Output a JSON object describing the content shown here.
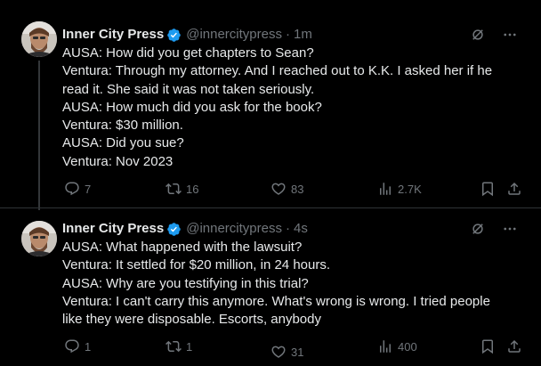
{
  "tweets": [
    {
      "name": "Inner City Press",
      "handle": "@innercitypress",
      "dot": "·",
      "time": "1m",
      "lines": [
        "AUSA: How did you get chapters to Sean?",
        "Ventura: Through my attorney. And I reached out to K.K. I asked her if he",
        "read it. She said it was not taken seriously.",
        "AUSA: How much did you ask for the book?",
        "Ventura: $30 million.",
        "AUSA: Did you sue?",
        "Ventura: Nov 2023"
      ],
      "replies": "7",
      "reposts": "16",
      "likes": "83",
      "views": "2.7K"
    },
    {
      "name": "Inner City Press",
      "handle": "@innercitypress",
      "dot": "·",
      "time": "4s",
      "lines": [
        "AUSA: What happened with the lawsuit?",
        "Ventura: It settled for $20 million, in 24 hours.",
        "AUSA: Why are you testifying in this trial?",
        "Ventura: I can't carry this anymore. What's wrong is wrong. I tried people",
        "like they were disposable. Escorts, anybody"
      ],
      "replies": "1",
      "reposts": "1",
      "likes": "31",
      "views": "400"
    }
  ],
  "colors": {
    "background": "#000000",
    "text": "#e7e9ea",
    "muted": "#71767b",
    "verified": "#1d9bf0",
    "divider": "#2f3336"
  },
  "icons": [
    "verified-badge-icon",
    "grok-icon",
    "more-icon",
    "reply-icon",
    "repost-icon",
    "like-icon",
    "views-icon",
    "bookmark-icon",
    "share-icon"
  ]
}
